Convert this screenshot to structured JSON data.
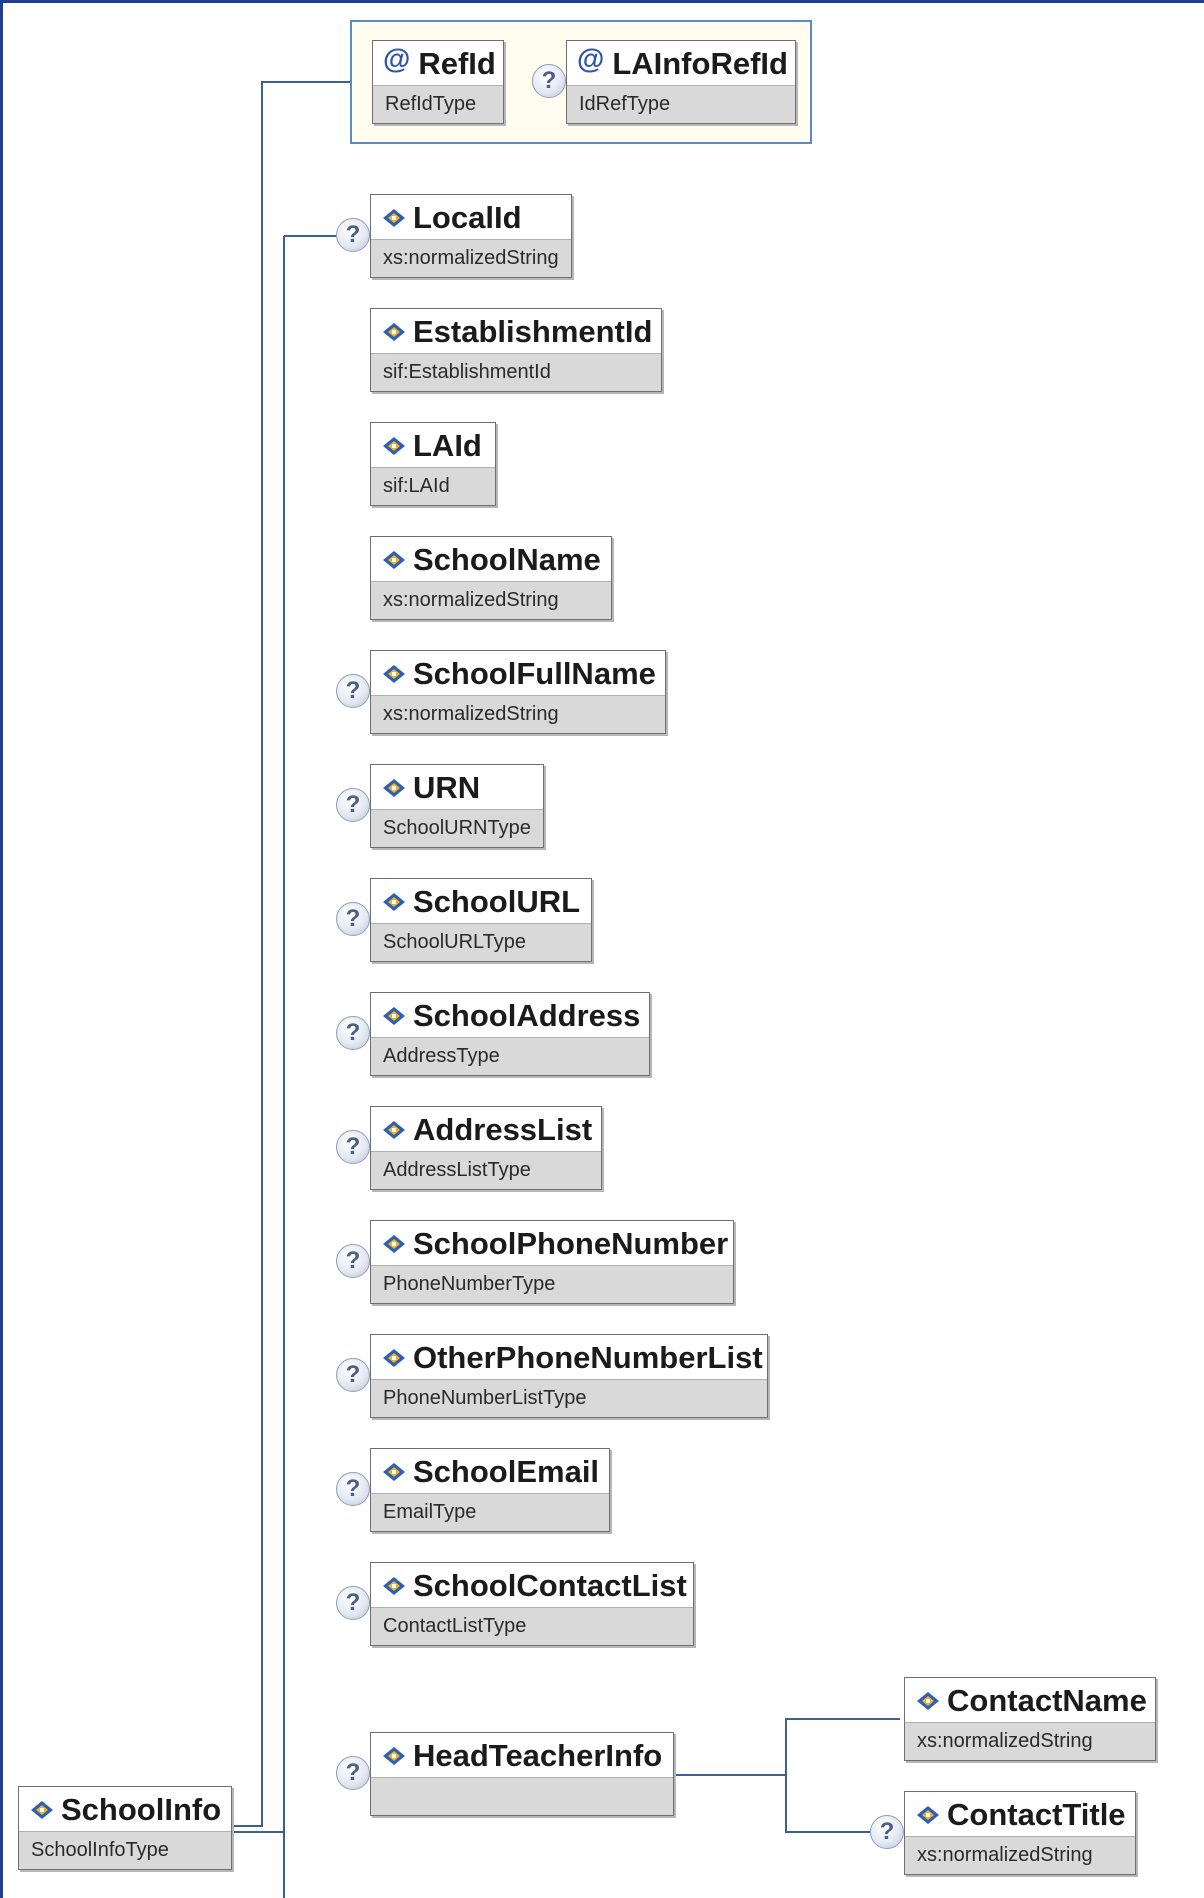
{
  "root": {
    "name": "SchoolInfo",
    "type": "SchoolInfoType",
    "icon": "element-icon"
  },
  "attributes": [
    {
      "name": "RefId",
      "type": "RefIdType",
      "icon": "attribute-icon",
      "optional": false
    },
    {
      "name": "LAInfoRefId",
      "type": "IdRefType",
      "icon": "attribute-icon",
      "optional": true
    }
  ],
  "elements": [
    {
      "name": "LocalId",
      "type": "xs:normalizedString",
      "optional": true
    },
    {
      "name": "EstablishmentId",
      "type": "sif:EstablishmentId",
      "optional": false
    },
    {
      "name": "LAId",
      "type": "sif:LAId",
      "optional": false
    },
    {
      "name": "SchoolName",
      "type": "xs:normalizedString",
      "optional": false
    },
    {
      "name": "SchoolFullName",
      "type": "xs:normalizedString",
      "optional": true
    },
    {
      "name": "URN",
      "type": "SchoolURNType",
      "optional": true
    },
    {
      "name": "SchoolURL",
      "type": "SchoolURLType",
      "optional": true
    },
    {
      "name": "SchoolAddress",
      "type": "AddressType",
      "optional": true
    },
    {
      "name": "AddressList",
      "type": "AddressListType",
      "optional": true
    },
    {
      "name": "SchoolPhoneNumber",
      "type": "PhoneNumberType",
      "optional": true
    },
    {
      "name": "OtherPhoneNumberList",
      "type": "PhoneNumberListType",
      "optional": true
    },
    {
      "name": "SchoolEmail",
      "type": "EmailType",
      "optional": true
    },
    {
      "name": "SchoolContactList",
      "type": "ContactListType",
      "optional": true
    },
    {
      "name": "HeadTeacherInfo",
      "type": "",
      "optional": true
    }
  ],
  "head_teacher_children": [
    {
      "name": "ContactName",
      "type": "xs:normalizedString",
      "optional": false
    },
    {
      "name": "ContactTitle",
      "type": "xs:normalizedString",
      "optional": true
    }
  ],
  "optional_marker": "?",
  "attribute_marker": "@",
  "colors": {
    "frame": "#1f3f8f",
    "connector": "#3c5f99",
    "attribute_bg": "#fffdf0",
    "type_bg": "#d9d9d9"
  }
}
